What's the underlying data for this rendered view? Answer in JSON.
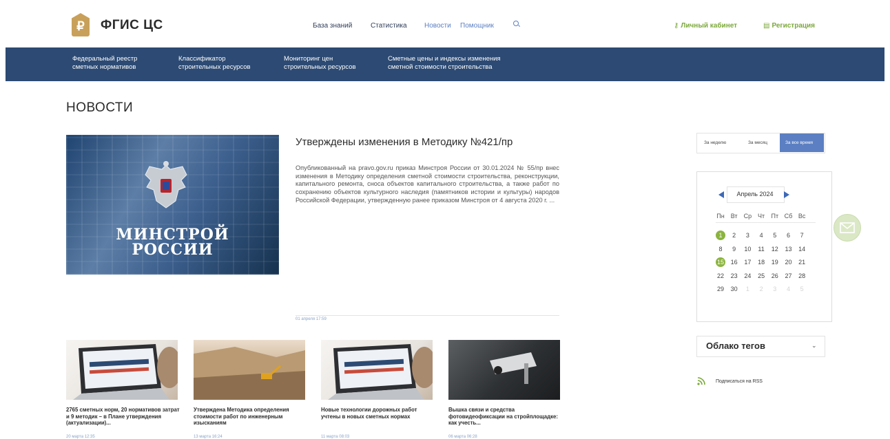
{
  "header": {
    "logo_glyph": "₽",
    "logo_text": "ФГИС ЦС",
    "nav": [
      "База знаний",
      "Статистика",
      "Новости",
      "Помощник"
    ],
    "account": "Личный кабинет",
    "register": "Регистрация",
    "account_icon": "key-icon",
    "register_icon": "form-icon"
  },
  "band": {
    "items": [
      [
        "Федеральный реестр",
        "сметных нормативов"
      ],
      [
        "Классификатор",
        "строительных ресурсов"
      ],
      [
        "Мониторинг цен",
        "строительных ресурсов"
      ],
      [
        "Сметные цены и индексы изменения",
        "сметной стоимости строительства"
      ]
    ]
  },
  "page_title": "НОВОСТИ",
  "featured": {
    "image_text_1": "МИНСТРОЙ",
    "image_text_2": "РОССИИ",
    "title": "Утверждены изменения в Методику №421/пр",
    "text": "Опубликованный на pravo.gov.ru приказ Минстроя России от 30.01.2024 № 55/пр внес изменения в Методику определения сметной стоимости строительства, реконструкции, капитального ремонта, сноса объектов капитального строительства, а также работ по сохранению объектов культурного наследия (памятников истории и культуры) народов Российской Федерации, утвержденную ранее приказом Минстроя от 4 августа 2020 г. ...",
    "date": "01 апреля 17:59"
  },
  "cards": [
    {
      "title": "2765 сметных норм, 20 нормативов затрат и 9 методик – в Плане утверждения (актуализации)...",
      "date": "20 марта 12:35"
    },
    {
      "title": "Утверждена Методика определения стоимости работ по инженерным изысканиям",
      "date": "13 марта 16:24"
    },
    {
      "title": "Новые технологии дорожных работ учтены в новых сметных нормах",
      "date": "11 марта 08:03"
    },
    {
      "title": "Вышка связи и средства фотовидеофиксации на стройплощадке: как учесть...",
      "date": "06 марта 06:28"
    }
  ],
  "filter": {
    "week": "За неделю",
    "month": "За месяц",
    "all": "За все время"
  },
  "calendar": {
    "month": "Апрель 2024",
    "weekdays": [
      "Пн",
      "Вт",
      "Ср",
      "Чт",
      "Пт",
      "Сб",
      "Вс"
    ],
    "weeks": [
      [
        "1",
        "2",
        "3",
        "4",
        "5",
        "6",
        "7"
      ],
      [
        "8",
        "9",
        "10",
        "11",
        "12",
        "13",
        "14"
      ],
      [
        "15",
        "16",
        "17",
        "18",
        "19",
        "20",
        "21"
      ],
      [
        "22",
        "23",
        "24",
        "25",
        "26",
        "27",
        "28"
      ],
      [
        "29",
        "30",
        "1",
        "2",
        "3",
        "4",
        "5"
      ]
    ],
    "marked": [
      "1",
      "15"
    ]
  },
  "tags_label": "Облако тегов",
  "rss_label": "Подписаться на RSS",
  "colors": {
    "brand_gold": "#c9a05a",
    "nav_band": "#2c4a73",
    "accent_green": "#8bb43f",
    "accent_blue": "#5b7fc2"
  }
}
